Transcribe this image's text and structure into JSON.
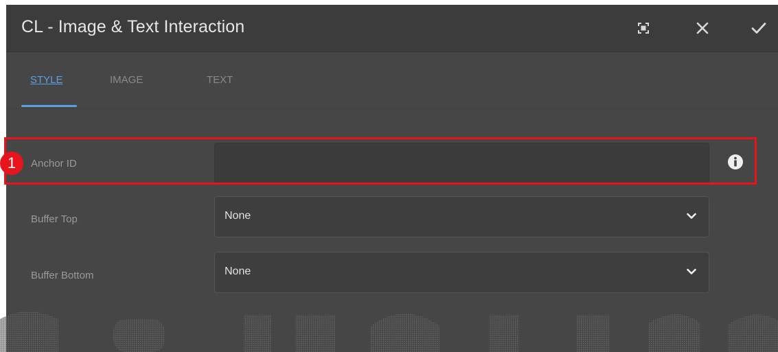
{
  "dialog": {
    "title": "CL - Image & Text Interaction",
    "actions": [
      "fullscreen-icon",
      "close-icon",
      "check-icon"
    ]
  },
  "tabs": [
    {
      "label": "STYLE",
      "active": true
    },
    {
      "label": "IMAGE",
      "active": false
    },
    {
      "label": "TEXT",
      "active": false
    }
  ],
  "fields": {
    "anchor_id": {
      "label": "Anchor ID",
      "value": ""
    },
    "buffer_top": {
      "label": "Buffer Top",
      "value": "None"
    },
    "buffer_bottom": {
      "label": "Buffer Bottom",
      "value": "None"
    }
  },
  "annotation": {
    "step": "1",
    "color": "#e8141c"
  },
  "colors": {
    "accent": "#5a9ee6",
    "dialog_bg": "#464646",
    "titlebar_bg": "#3c3c3c"
  }
}
